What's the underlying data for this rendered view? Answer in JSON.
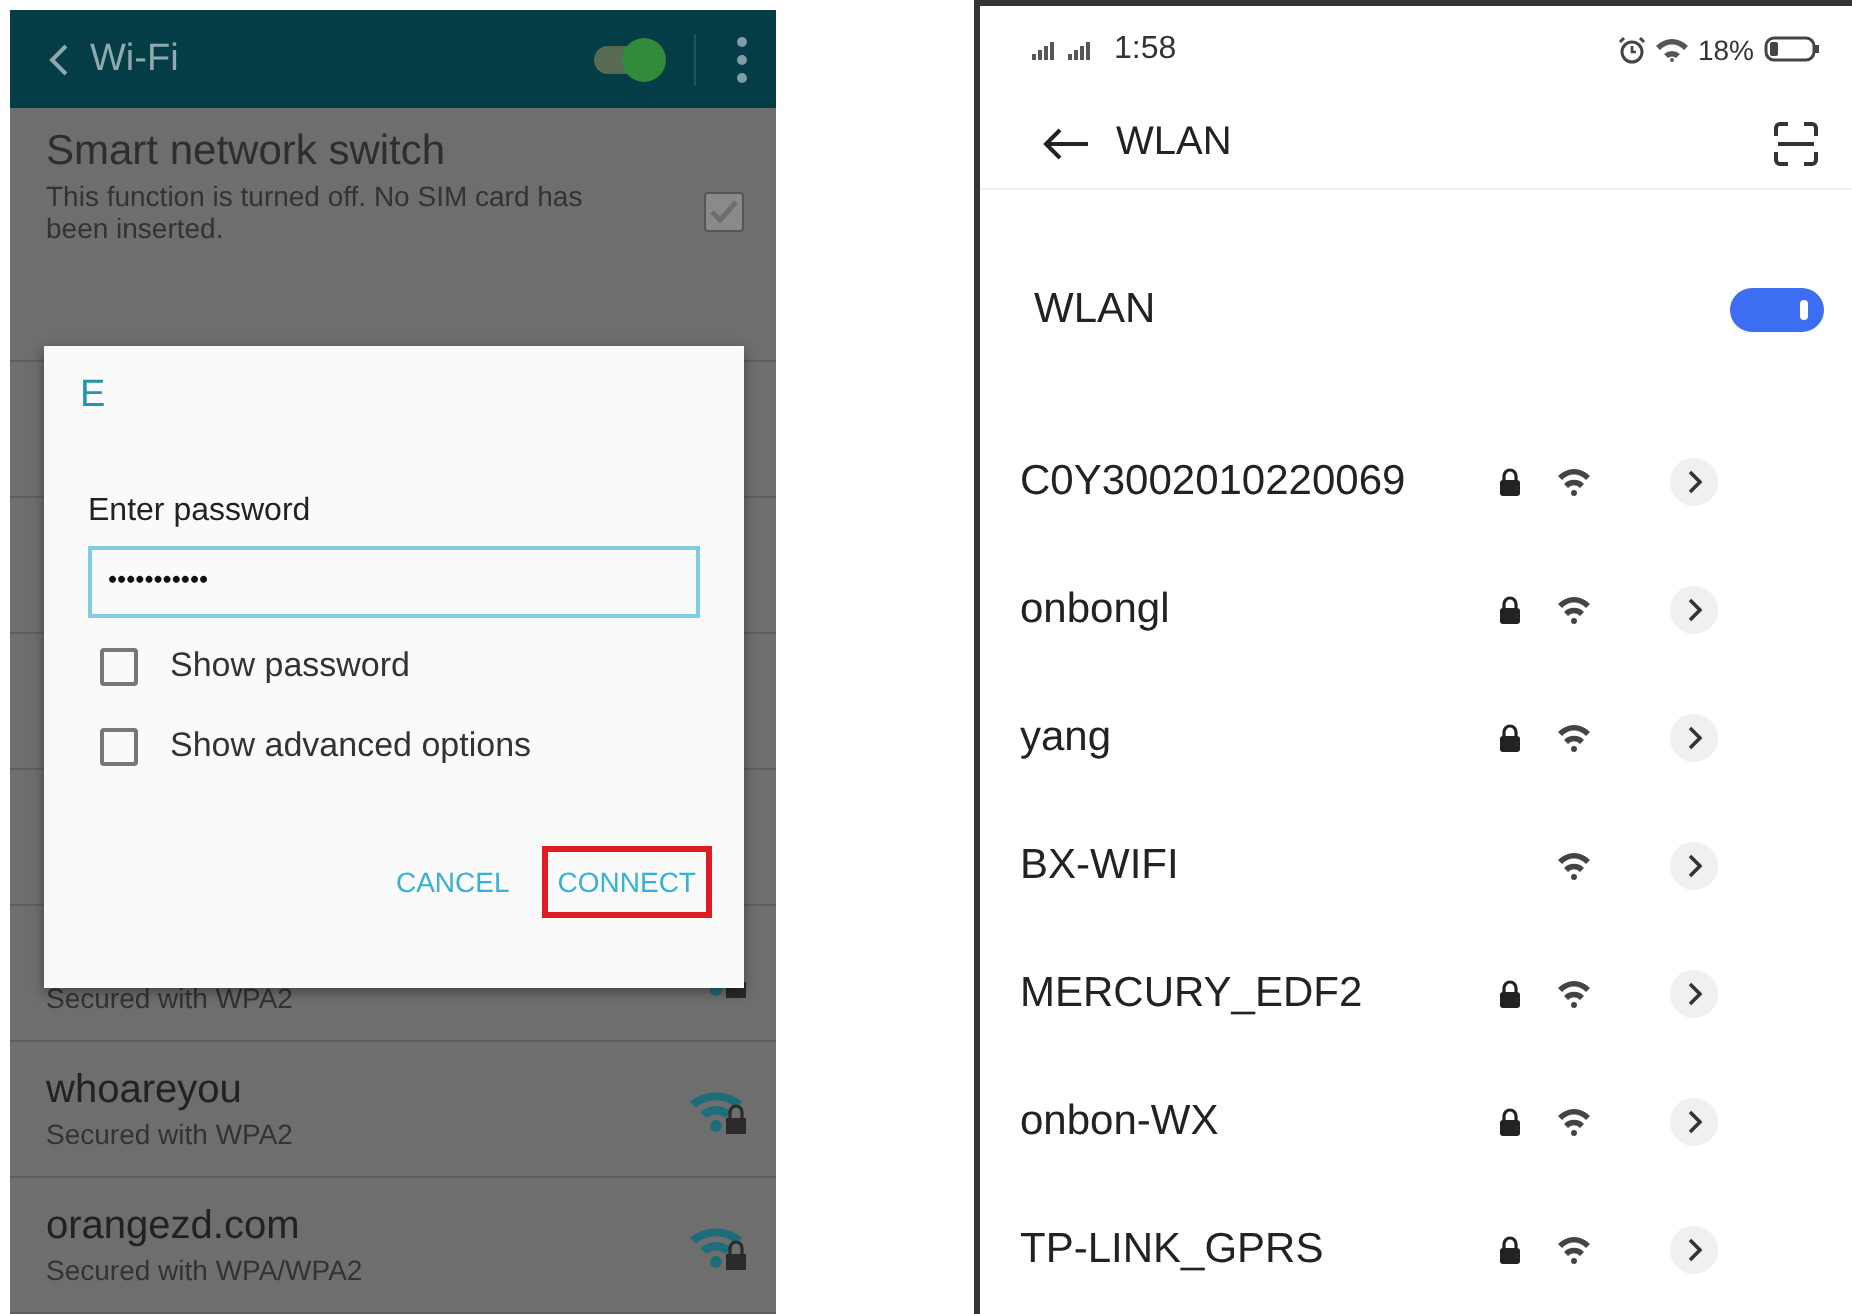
{
  "left_screen": {
    "app_bar": {
      "title": "Wi-Fi",
      "wifi_on": true
    },
    "smart_network_switch": {
      "title": "Smart network switch",
      "description": "This function is turned off. No SIM card has been inserted.",
      "checked": true
    },
    "networks": [
      {
        "security": "Secured with WPA2",
        "locked": true
      },
      {
        "name": "whoareyou",
        "security": "Secured with WPA2",
        "locked": true
      },
      {
        "name": "orangezd.com",
        "security": "Secured with WPA/WPA2",
        "locked": true
      }
    ],
    "dialog": {
      "title": "E",
      "label": "Enter password",
      "password": "•••••••••••",
      "options": [
        {
          "label": "Show password",
          "checked": false
        },
        {
          "label": "Show advanced options",
          "checked": false
        }
      ],
      "buttons": [
        {
          "label": "CANCEL",
          "highlighted": false
        },
        {
          "label": "CONNECT",
          "highlighted": true
        }
      ]
    }
  },
  "right_screen": {
    "status_bar": {
      "time": "1:58",
      "battery": "18%"
    },
    "app_bar": {
      "title": "WLAN"
    },
    "wlan_switch": {
      "label": "WLAN",
      "on": true
    },
    "networks": [
      {
        "name": "C0Y3002010220069",
        "locked": true
      },
      {
        "name": "onbongl",
        "locked": true
      },
      {
        "name": "yang",
        "locked": true
      },
      {
        "name": "BX-WIFI",
        "locked": false
      },
      {
        "name": "MERCURY_EDF2",
        "locked": true
      },
      {
        "name": "onbon-WX",
        "locked": true
      },
      {
        "name": "TP-LINK_GPRS",
        "locked": true
      }
    ]
  }
}
